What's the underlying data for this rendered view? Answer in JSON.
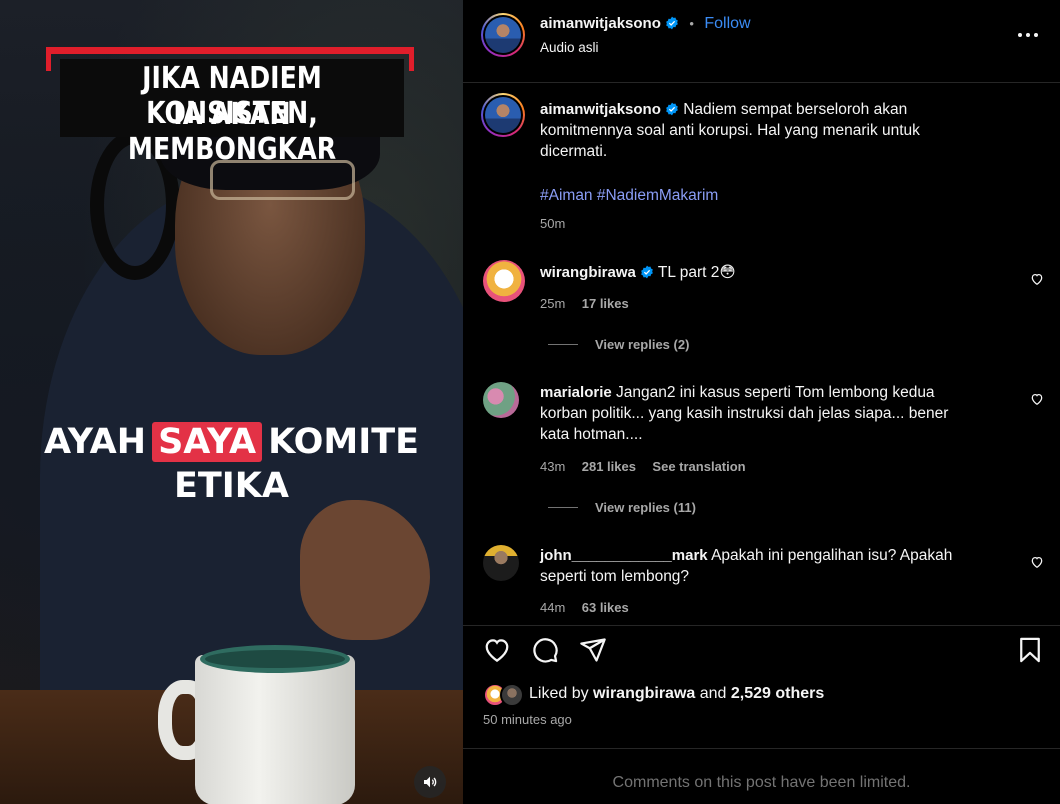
{
  "video": {
    "headline_line1": "JIKA NADIEM KONSISTEN,",
    "headline_line2": "IA AKAN MEMBONGKAR",
    "caption_word1": "AYAH",
    "caption_word2": "SAYA",
    "caption_word3": "KOMITE",
    "caption_line2": "ETIKA"
  },
  "header": {
    "username": "aimanwitjaksono",
    "separator": "•",
    "follow_label": "Follow",
    "audio": "Audio asli",
    "more_icon": "more-horizontal-icon"
  },
  "post": {
    "username": "aimanwitjaksono",
    "text": "Nadiem sempat berseloroh akan komitmennya soal anti korupsi. Hal yang menarik untuk dicermati.",
    "hashtags": "#Aiman #NadiemMakarim",
    "time": "50m"
  },
  "comments": [
    {
      "username": "wirangbirawa",
      "text": "TL part 2😳",
      "time": "25m",
      "likes": "17 likes",
      "view_replies": "View replies (2)",
      "verified": true
    },
    {
      "username": "marialorie",
      "text": "Jangan2 ini kasus seperti Tom lembong kedua korban politik... yang kasih instruksi dah jelas siapa... bener kata hotman....",
      "time": "43m",
      "likes": "281 likes",
      "see_translation": "See translation",
      "view_replies": "View replies (11)"
    },
    {
      "username": "john____________mark",
      "text": "Apakah ini pengalihan isu? Apakah seperti tom lembong?",
      "time": "44m",
      "likes": "63 likes"
    }
  ],
  "actions": {
    "like_icon": "heart-icon",
    "comment_icon": "comment-icon",
    "share_icon": "send-icon",
    "save_icon": "bookmark-icon"
  },
  "likes": {
    "prefix": "Liked by",
    "user": "wirangbirawa",
    "conjunction": "and",
    "others": "2,529 others",
    "time": "50 minutes ago"
  },
  "footer": {
    "limited": "Comments on this post have been limited."
  },
  "colors": {
    "follow_blue": "#0095f6",
    "hashtag": "#8a9df5",
    "verified_blue": "#0095f6",
    "headline_red": "#e01e2b",
    "caption_highlight": "#e33246"
  }
}
